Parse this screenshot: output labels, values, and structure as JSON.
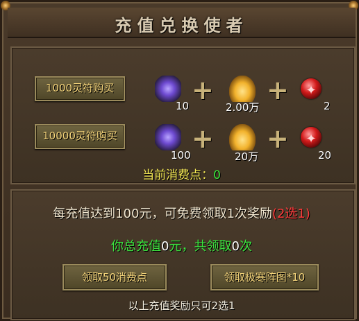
{
  "title": "充值兑换使者",
  "buy_buttons": [
    {
      "label": "1000灵符购买"
    },
    {
      "label": "10000灵符购买"
    }
  ],
  "rewards": [
    [
      {
        "icon": "rune-icon",
        "qty": "10"
      },
      {
        "icon": "gold-ingot-icon",
        "qty": "2.00万"
      },
      {
        "icon": "red-orb-icon",
        "qty": "2"
      }
    ],
    [
      {
        "icon": "rune-icon",
        "qty": "100"
      },
      {
        "icon": "gold-ingot-icon",
        "qty": "20万"
      },
      {
        "icon": "red-orb-icon",
        "qty": "20"
      }
    ]
  ],
  "consume": {
    "label": "当前消费点：",
    "value": "0"
  },
  "info": {
    "line1_text": "每充值达到100元，可免费领取1次奖励",
    "line1_highlight": "(2选1)",
    "line2_a": "你总充值",
    "line2_amount": "0",
    "line2_b": "元，共领取",
    "line2_count": "0",
    "line2_c": "次"
  },
  "claim_buttons": [
    {
      "label": "领取50消费点"
    },
    {
      "label": "领取极寒阵图*10"
    }
  ],
  "note": "以上充值奖励只可2选1",
  "colors": {
    "accent_yellow": "#f6ea55",
    "green": "#39e63a",
    "red": "#ff3b3b"
  }
}
